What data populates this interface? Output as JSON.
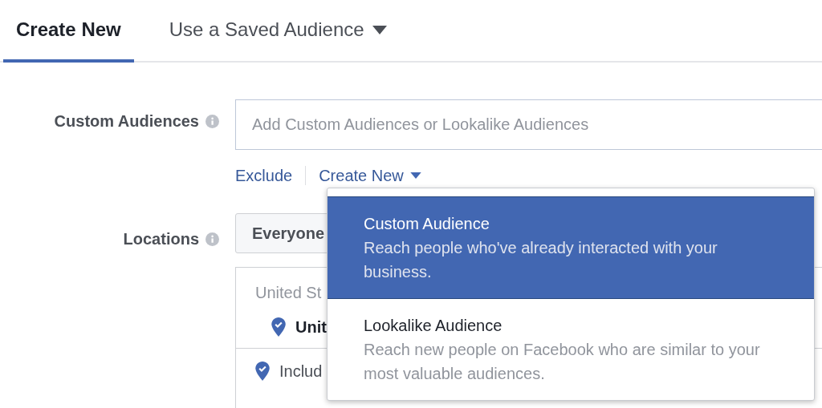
{
  "tabs": [
    {
      "label": "Create New",
      "selected": true,
      "kind": "plain"
    },
    {
      "label": "Use a Saved Audience",
      "selected": false,
      "kind": "dropdown"
    }
  ],
  "custom_audiences": {
    "label": "Custom Audiences",
    "placeholder": "Add Custom Audiences or Lookalike Audiences",
    "links": [
      {
        "label": "Exclude",
        "kind": "plain"
      },
      {
        "label": "Create New",
        "kind": "dropdown"
      }
    ]
  },
  "locations": {
    "label": "Locations",
    "audience_button": "Everyone",
    "header": "United St",
    "location": "Unit",
    "include": "Includ"
  },
  "dropdown": {
    "items": [
      {
        "title": "Custom Audience",
        "description": "Reach people who've already interacted with your business.",
        "selected": true
      },
      {
        "title": "Lookalike Audience",
        "description": "Reach new people on Facebook who are similar to your most valuable audiences.",
        "selected": false
      }
    ]
  }
}
